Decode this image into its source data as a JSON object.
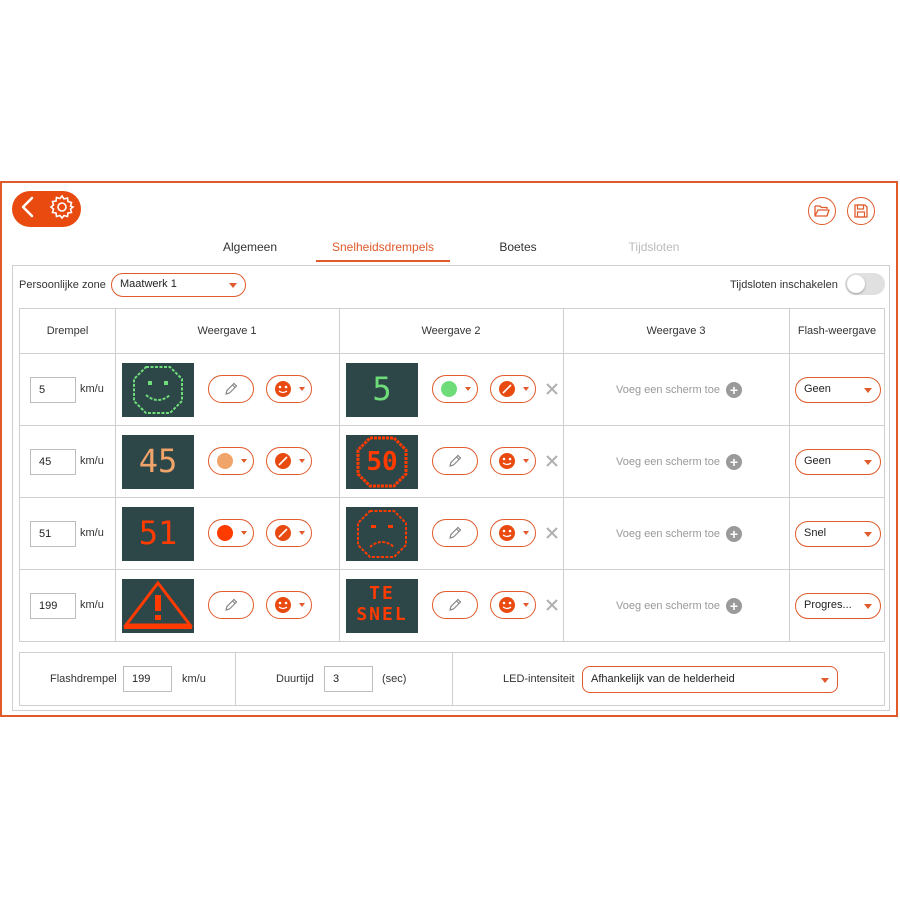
{
  "tabs": [
    {
      "label": "Algemeen",
      "state": "normal"
    },
    {
      "label": "Snelheidsdrempels",
      "state": "active"
    },
    {
      "label": "Boetes",
      "state": "normal"
    },
    {
      "label": "Tijdsloten",
      "state": "disabled"
    }
  ],
  "zone": {
    "label": "Persoonlijke zone",
    "value": "Maatwerk 1"
  },
  "timeslots": {
    "label": "Tijdsloten inschakelen",
    "enabled": false
  },
  "columns": [
    "Drempel",
    "Weergave 1",
    "Weergave 2",
    "Weergave 3",
    "Flash-weergave"
  ],
  "rows": [
    {
      "threshold": "5",
      "unit": "km/u",
      "add_screen": "Voeg een scherm toe",
      "flash": "Geen",
      "screen2_text": "5",
      "color2": "#6fdc7a"
    },
    {
      "threshold": "45",
      "unit": "km/u",
      "add_screen": "Voeg een scherm toe",
      "flash": "Geen",
      "screen1_text": "45",
      "color1": "#f0a46a"
    },
    {
      "threshold": "51",
      "unit": "km/u",
      "add_screen": "Voeg een scherm toe",
      "flash": "Snel",
      "screen1_text": "51",
      "color1": "#ff3b00"
    },
    {
      "threshold": "199",
      "unit": "km/u",
      "add_screen": "Voeg een scherm toe",
      "flash": "Progres...",
      "screen2_line1": "TE",
      "screen2_line2": "SNEL"
    }
  ],
  "sign_50": "50",
  "bottom": {
    "flash_label": "Flashdrempel",
    "flash_value": "199",
    "flash_unit": "km/u",
    "duration_label": "Duurtijd",
    "duration_value": "3",
    "duration_unit": "(sec)",
    "led_label": "LED-intensiteit",
    "led_value": "Afhankelijk van de helderheid"
  },
  "colors": {
    "accent": "#e05a2b",
    "screen_bg": "#2d4648",
    "green": "#6fdc7a",
    "orange_light": "#f0a46a",
    "red": "#ff3b00"
  },
  "icons": [
    "back-icon",
    "gear-icon",
    "open-folder-icon",
    "save-icon",
    "edit-pencil-icon",
    "smiley-icon",
    "slash-icon",
    "close-icon",
    "add-icon"
  ]
}
